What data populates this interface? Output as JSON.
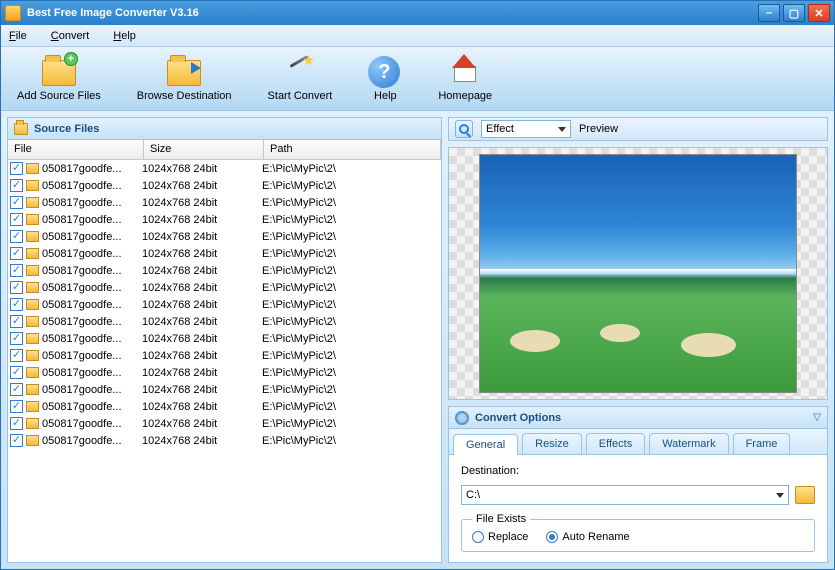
{
  "window": {
    "title": "Best Free Image Converter V3.16"
  },
  "menu": {
    "file": "File",
    "convert": "Convert",
    "help": "Help"
  },
  "toolbar": {
    "add": "Add Source Files",
    "browse": "Browse Destination",
    "start": "Start Convert",
    "help": "Help",
    "home": "Homepage"
  },
  "sourcePanel": {
    "title": "Source Files",
    "columns": {
      "file": "File",
      "size": "Size",
      "path": "Path"
    },
    "rows": [
      {
        "checked": true,
        "file": "050817goodfe...",
        "size": "1024x768  24bit",
        "path": "E:\\Pic\\MyPic\\2\\"
      },
      {
        "checked": true,
        "file": "050817goodfe...",
        "size": "1024x768  24bit",
        "path": "E:\\Pic\\MyPic\\2\\"
      },
      {
        "checked": true,
        "file": "050817goodfe...",
        "size": "1024x768  24bit",
        "path": "E:\\Pic\\MyPic\\2\\"
      },
      {
        "checked": true,
        "file": "050817goodfe...",
        "size": "1024x768  24bit",
        "path": "E:\\Pic\\MyPic\\2\\"
      },
      {
        "checked": true,
        "file": "050817goodfe...",
        "size": "1024x768  24bit",
        "path": "E:\\Pic\\MyPic\\2\\"
      },
      {
        "checked": true,
        "file": "050817goodfe...",
        "size": "1024x768  24bit",
        "path": "E:\\Pic\\MyPic\\2\\"
      },
      {
        "checked": true,
        "file": "050817goodfe...",
        "size": "1024x768  24bit",
        "path": "E:\\Pic\\MyPic\\2\\"
      },
      {
        "checked": true,
        "file": "050817goodfe...",
        "size": "1024x768  24bit",
        "path": "E:\\Pic\\MyPic\\2\\"
      },
      {
        "checked": true,
        "file": "050817goodfe...",
        "size": "1024x768  24bit",
        "path": "E:\\Pic\\MyPic\\2\\"
      },
      {
        "checked": true,
        "file": "050817goodfe...",
        "size": "1024x768  24bit",
        "path": "E:\\Pic\\MyPic\\2\\"
      },
      {
        "checked": true,
        "file": "050817goodfe...",
        "size": "1024x768  24bit",
        "path": "E:\\Pic\\MyPic\\2\\"
      },
      {
        "checked": true,
        "file": "050817goodfe...",
        "size": "1024x768  24bit",
        "path": "E:\\Pic\\MyPic\\2\\"
      },
      {
        "checked": true,
        "file": "050817goodfe...",
        "size": "1024x768  24bit",
        "path": "E:\\Pic\\MyPic\\2\\"
      },
      {
        "checked": true,
        "file": "050817goodfe...",
        "size": "1024x768  24bit",
        "path": "E:\\Pic\\MyPic\\2\\"
      },
      {
        "checked": true,
        "file": "050817goodfe...",
        "size": "1024x768  24bit",
        "path": "E:\\Pic\\MyPic\\2\\"
      },
      {
        "checked": true,
        "file": "050817goodfe...",
        "size": "1024x768  24bit",
        "path": "E:\\Pic\\MyPic\\2\\"
      },
      {
        "checked": true,
        "file": "050817goodfe...",
        "size": "1024x768  24bit",
        "path": "E:\\Pic\\MyPic\\2\\"
      }
    ]
  },
  "effect": {
    "label": "Effect",
    "preview": "Preview"
  },
  "options": {
    "title": "Convert Options",
    "tabs": {
      "general": "General",
      "resize": "Resize",
      "effects": "Effects",
      "watermark": "Watermark",
      "frame": "Frame"
    },
    "general": {
      "destLabel": "Destination:",
      "destValue": "C:\\",
      "fileExistsLegend": "File Exists",
      "replace": "Replace",
      "autoRename": "Auto Rename",
      "selected": "autoRename"
    }
  }
}
